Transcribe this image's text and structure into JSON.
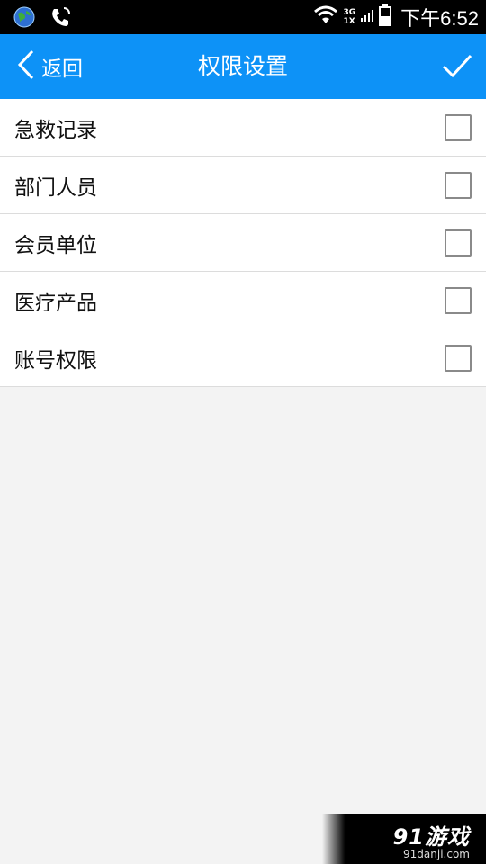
{
  "status_bar": {
    "network_top": "3G",
    "network_bottom": "1X",
    "time": "下午6:52"
  },
  "header": {
    "back_label": "返回",
    "title": "权限设置",
    "accent_color": "#0d92f7"
  },
  "permissions": [
    {
      "label": "急救记录",
      "checked": false
    },
    {
      "label": "部门人员",
      "checked": false
    },
    {
      "label": "会员单位",
      "checked": false
    },
    {
      "label": "医疗产品",
      "checked": false
    },
    {
      "label": "账号权限",
      "checked": false
    }
  ],
  "watermark": {
    "logo": "91游戏",
    "site": "91danji.com"
  }
}
